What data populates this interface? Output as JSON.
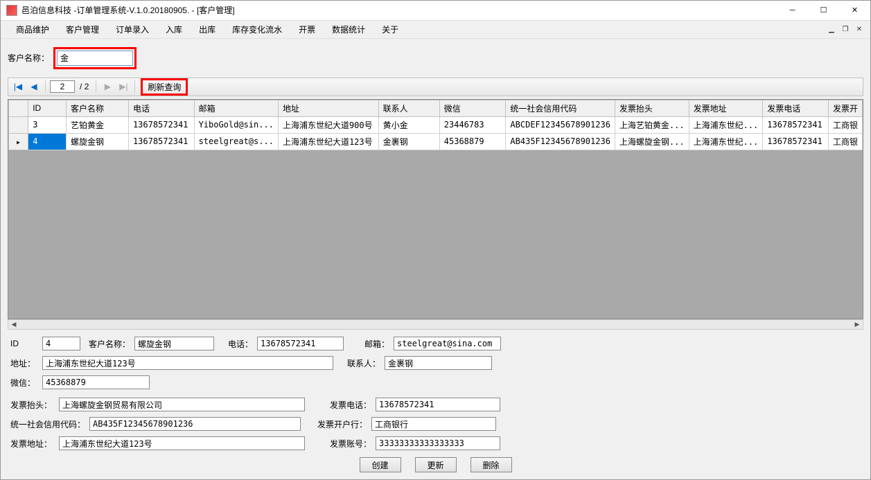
{
  "window": {
    "title": "邑泊信息科技 -订单管理系统-V.1.0.20180905. - [客户管理]"
  },
  "menubar": {
    "items": [
      "商品维护",
      "客户管理",
      "订单录入",
      "入库",
      "出库",
      "库存变化流水",
      "开票",
      "数据统计",
      "关于"
    ]
  },
  "search": {
    "label": "客户名称：",
    "value": "金"
  },
  "pager": {
    "current": "2",
    "separator": "/",
    "total": "2",
    "refresh_label": "刷新查询"
  },
  "grid": {
    "columns": [
      "ID",
      "客户名称",
      "电话",
      "邮箱",
      "地址",
      "联系人",
      "微信",
      "统一社会信用代码",
      "发票抬头",
      "发票地址",
      "发票电话",
      "发票开"
    ],
    "rows": [
      {
        "selected": false,
        "cells": [
          "3",
          "艺铂黄金",
          "13678572341",
          "YiboGold@sin...",
          "上海浦东世纪大道900号",
          "黄小金",
          "23446783",
          "ABCDEF12345678901236",
          "上海艺铂黄金...",
          "上海浦东世纪...",
          "13678572341",
          "工商银"
        ]
      },
      {
        "selected": true,
        "cells": [
          "4",
          "螺旋金钢",
          "13678572341",
          "steelgreat@s...",
          "上海浦东世纪大道123号",
          "金裹钢",
          "45368879",
          "AB435F12345678901236",
          "上海螺旋金钢...",
          "上海浦东世纪...",
          "13678572341",
          "工商银"
        ]
      }
    ]
  },
  "detail": {
    "labels": {
      "id": "ID",
      "name": "客户名称：",
      "phone": "电话：",
      "email": "邮箱：",
      "address": "地址：",
      "contact": "联系人：",
      "wechat": "微信：",
      "invoice_title": "发票抬头：",
      "invoice_phone": "发票电话：",
      "credit_code": "统一社会信用代码：",
      "invoice_bank": "发票开户行：",
      "invoice_address": "发票地址：",
      "invoice_account": "发票账号："
    },
    "values": {
      "id": "4",
      "name": "螺旋金钢",
      "phone": "13678572341",
      "email": "steelgreat@sina.com",
      "address": "上海浦东世纪大道123号",
      "contact": "金裹钢",
      "wechat": "45368879",
      "invoice_title": "上海螺旋金钢贸易有限公司",
      "invoice_phone": "13678572341",
      "credit_code": "AB435F12345678901236",
      "invoice_bank": "工商银行",
      "invoice_address": "上海浦东世纪大道123号",
      "invoice_account": "33333333333333333"
    },
    "buttons": {
      "create": "创建",
      "update": "更新",
      "delete": "删除"
    }
  }
}
